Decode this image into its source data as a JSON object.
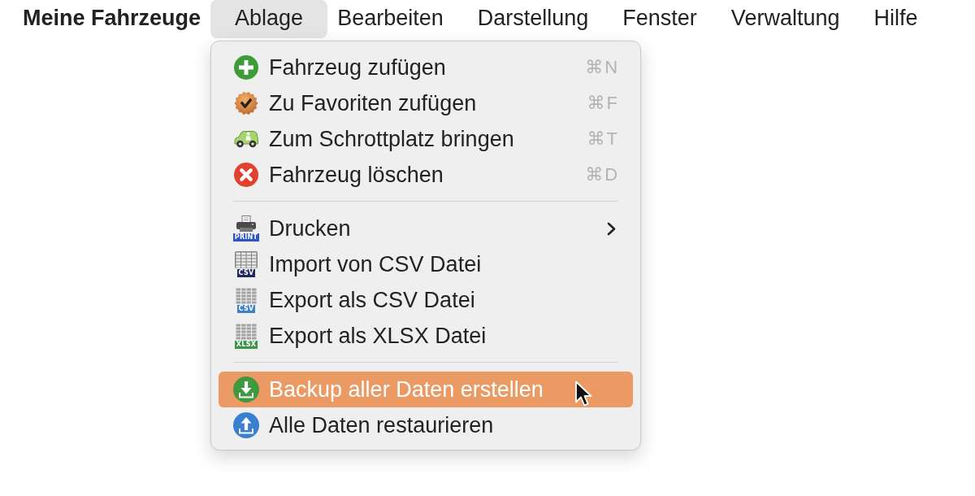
{
  "menubar": {
    "app_name": "Meine Fahrzeuge",
    "menus": [
      {
        "label": "Ablage",
        "selected": true
      },
      {
        "label": "Bearbeiten",
        "selected": false
      },
      {
        "label": "Darstellung",
        "selected": false
      },
      {
        "label": "Fenster",
        "selected": false
      },
      {
        "label": "Verwaltung",
        "selected": false
      },
      {
        "label": "Hilfe",
        "selected": false
      }
    ]
  },
  "open_menu": {
    "groups": [
      {
        "items": [
          {
            "label": "Fahrzeug zufügen",
            "shortcut": "⌘N",
            "submenu": false,
            "selected": false
          },
          {
            "label": "Zu Favoriten zufügen",
            "shortcut": "⌘F",
            "submenu": false,
            "selected": false
          },
          {
            "label": "Zum Schrottplatz bringen",
            "shortcut": "⌘T",
            "submenu": false,
            "selected": false
          },
          {
            "label": "Fahrzeug löschen",
            "shortcut": "⌘D",
            "submenu": false,
            "selected": false
          }
        ]
      },
      {
        "items": [
          {
            "label": "Drucken",
            "icon_label": "PRINT",
            "submenu": true,
            "selected": false
          },
          {
            "label": "Import von CSV Datei",
            "icon_label": "CSV",
            "submenu": false,
            "selected": false
          },
          {
            "label": "Export als CSV Datei",
            "icon_label": "CSV",
            "submenu": false,
            "selected": false
          },
          {
            "label": "Export als XLSX Datei",
            "icon_label": "XLSX",
            "submenu": false,
            "selected": false
          }
        ]
      },
      {
        "items": [
          {
            "label": "Backup aller Daten erstellen",
            "submenu": false,
            "selected": true
          },
          {
            "label": "Alle Daten restaurieren",
            "submenu": false,
            "selected": false
          }
        ]
      }
    ]
  }
}
